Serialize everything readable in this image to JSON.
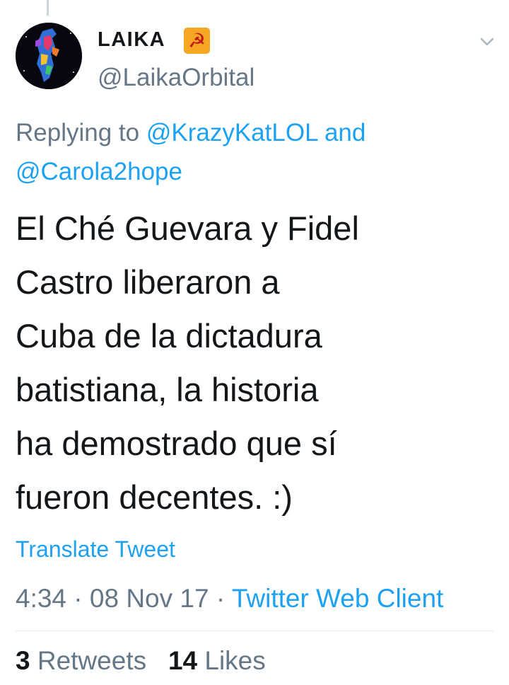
{
  "tweet": {
    "author": {
      "display_name": "LAIKA",
      "badge_emoji": "☭",
      "handle": "@LaikaOrbital"
    },
    "replying_prefix": "Replying to",
    "replying_to": [
      "@KrazyKatLOL",
      "@Carola2hope"
    ],
    "replying_conjunction": "and",
    "text": "El Ché Guevara y Fidel\nCastro liberaron a\nCuba de la dictadura\nbatistiana, la historia\nha demostrado que sí\nfueron decentes. :)",
    "translate_label": "Translate Tweet",
    "time": "4:34",
    "separator": "·",
    "date": "08 Nov 17",
    "client": "Twitter Web Client",
    "retweets_count": "3",
    "retweets_label": "Retweets",
    "likes_count": "14",
    "likes_label": "Likes"
  },
  "colors": {
    "link": "#1da1f2",
    "secondary": "#657786",
    "primary": "#14171a",
    "badge_bg": "#f5a623"
  },
  "icons": {
    "menu": "chevron-down-icon",
    "badge": "hammer-sickle-emoji"
  }
}
